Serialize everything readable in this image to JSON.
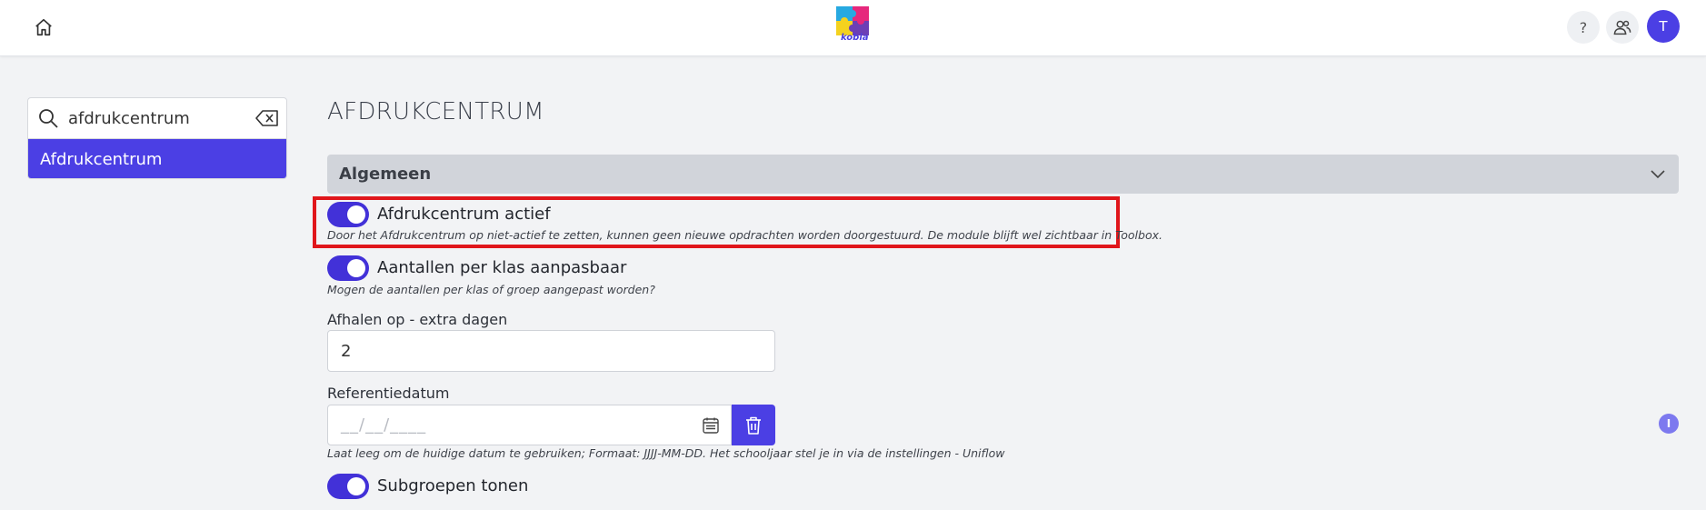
{
  "header": {
    "logo_text": "kobia",
    "help_label": "?",
    "avatar_initial": "T"
  },
  "search": {
    "value": "afdrukcentrum",
    "result": "Afdrukcentrum"
  },
  "page": {
    "title": "AFDRUKCENTRUM"
  },
  "section": {
    "title": "Algemeen"
  },
  "settings": {
    "afdrukcentrum_actief": {
      "label": "Afdrukcentrum actief",
      "help": "Door het Afdrukcentrum op niet-actief te zetten, kunnen geen nieuwe opdrachten worden doorgestuurd. De module blijft wel zichtbaar in Toolbox.",
      "on": true
    },
    "aantallen_aanpasbaar": {
      "label": "Aantallen per klas aanpasbaar",
      "help": "Mogen de aantallen per klas of groep aangepast worden?",
      "on": true
    },
    "afhalen": {
      "label": "Afhalen op - extra dagen",
      "value": "2"
    },
    "referentiedatum": {
      "label": "Referentiedatum",
      "placeholder": "__/__/____",
      "help": "Laat leeg om de huidige datum te gebruiken; Formaat: JJJJ-MM-DD. Het schooljaar stel je in via de instellingen - Uniflow"
    },
    "subgroepen": {
      "label": "Subgroepen tonen",
      "on": true
    }
  },
  "info_badge": "I",
  "colors": {
    "accent": "#4b3fe4",
    "toggle": "#4231d8",
    "highlight": "#e0161b",
    "section_bg": "#d1d4da",
    "page_bg": "#f2f3f5"
  }
}
